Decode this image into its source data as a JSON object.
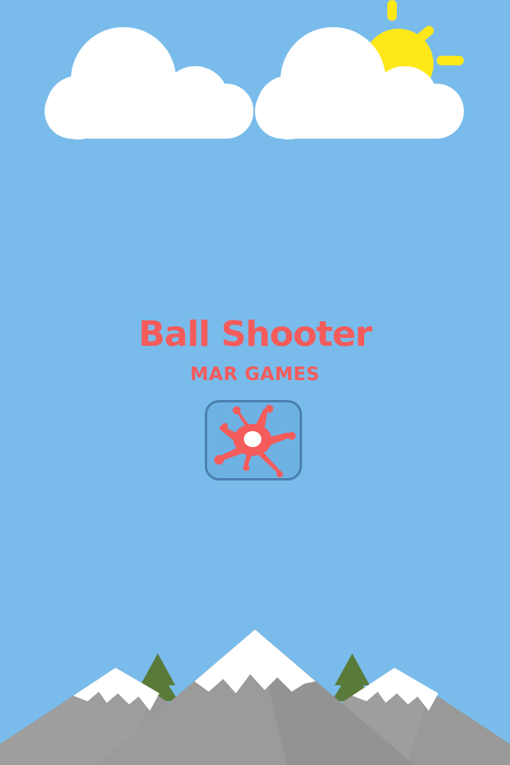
{
  "game": {
    "title": "Ball Shooter",
    "publisher": "MAR GAMES"
  },
  "play_button": {
    "icon": "paint-splat-icon"
  },
  "colors": {
    "sky": "#79BCEB",
    "title": "#F45B5B",
    "sun": "#FFE81A",
    "cloud": "#FFFFFF",
    "mountain": "#9E9E9E",
    "mountain_shadow": "#7E7E7E",
    "snow": "#FFFFFF",
    "tree": "#5A7A3A"
  }
}
